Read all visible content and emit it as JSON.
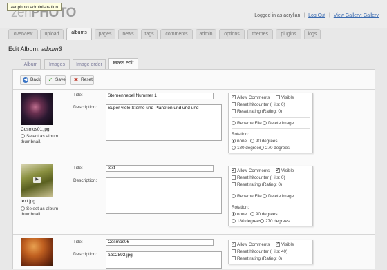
{
  "app": {
    "logo_zen": "zen",
    "logo_photo": "PHOTO",
    "tooltip": "zenphoto administration",
    "logged_in": "Logged in as acrylian",
    "logout": "Log Out",
    "view_gallery": "View Gallery: Gallery"
  },
  "nav": [
    "overview",
    "upload",
    "albums",
    "pages",
    "news",
    "tags",
    "comments",
    "admin",
    "options",
    "themes",
    "plugins",
    "logs"
  ],
  "page": {
    "title_prefix": "Edit Album:",
    "album_name": "album3"
  },
  "subtabs": [
    "Album",
    "Images",
    "Image order",
    "Mass edit"
  ],
  "toolbar": {
    "back": "Back",
    "save": "Save",
    "reset": "Reset"
  },
  "labels": {
    "title": "Title:",
    "description": "Description:",
    "thumb_select": "Select as album thumbnail.",
    "allow_comments": "Allow Comments",
    "visible": "Visible",
    "reset_rating": "Reset rating (Rating: 0)",
    "rename_file": "Rename File",
    "delete_image": "Delete image",
    "rotation": "Rotation:",
    "rot_none": "none",
    "rot_90": "90 degrees",
    "rot_180": "180 degrees",
    "rot_270": "270 degrees"
  },
  "images": [
    {
      "filename": "Cosmos01.jpg",
      "title": "Sternennebel Nummer 1",
      "description": "Super viele Sterne und Planeten und und und",
      "hitcounter": "Reset hitcounter (Hits: 0)",
      "allow_comments": true,
      "visible": false
    },
    {
      "filename": "text.jpg",
      "title": "text",
      "description": "",
      "hitcounter": "Reset hitcounter (Hits: 0)",
      "allow_comments": true,
      "visible": true
    },
    {
      "filename": "",
      "title": "Cosmos06",
      "description": "ab02892.jpg",
      "hitcounter": "Reset hitcounter (Hits: 40)",
      "allow_comments": true,
      "visible": true
    }
  ]
}
